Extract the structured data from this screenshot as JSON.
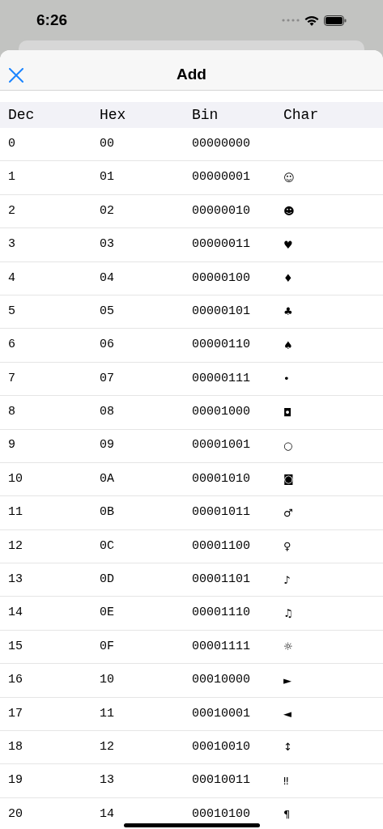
{
  "status_bar": {
    "time": "6:26"
  },
  "nav": {
    "title": "Add"
  },
  "table": {
    "columns": [
      "Dec",
      "Hex",
      "Bin",
      "Char"
    ],
    "rows": [
      {
        "dec": "0",
        "hex": "00",
        "bin": "00000000"
      },
      {
        "dec": "1",
        "hex": "01",
        "bin": "00000001",
        "char": "☺"
      },
      {
        "dec": "2",
        "hex": "02",
        "bin": "00000010",
        "char": "☻"
      },
      {
        "dec": "3",
        "hex": "03",
        "bin": "00000011",
        "char": "♥"
      },
      {
        "dec": "4",
        "hex": "04",
        "bin": "00000100",
        "char": "♦"
      },
      {
        "dec": "5",
        "hex": "05",
        "bin": "00000101",
        "char": "♣"
      },
      {
        "dec": "6",
        "hex": "06",
        "bin": "00000110",
        "char": "♠"
      },
      {
        "dec": "7",
        "hex": "07",
        "bin": "00000111",
        "char": "•"
      },
      {
        "dec": "8",
        "hex": "08",
        "bin": "00001000",
        "char": "◘"
      },
      {
        "dec": "9",
        "hex": "09",
        "bin": "00001001",
        "char": "○"
      },
      {
        "dec": "10",
        "hex": "0A",
        "bin": "00001010",
        "char": "◙"
      },
      {
        "dec": "11",
        "hex": "0B",
        "bin": "00001011",
        "char": "♂"
      },
      {
        "dec": "12",
        "hex": "0C",
        "bin": "00001100",
        "char": "♀"
      },
      {
        "dec": "13",
        "hex": "0D",
        "bin": "00001101",
        "char": "♪"
      },
      {
        "dec": "14",
        "hex": "0E",
        "bin": "00001110",
        "char": "♫"
      },
      {
        "dec": "15",
        "hex": "0F",
        "bin": "00001111",
        "char": "☼"
      },
      {
        "dec": "16",
        "hex": "10",
        "bin": "00010000",
        "char": "►"
      },
      {
        "dec": "17",
        "hex": "11",
        "bin": "00010001",
        "char": "◄"
      },
      {
        "dec": "18",
        "hex": "12",
        "bin": "00010010",
        "char": "↕"
      },
      {
        "dec": "19",
        "hex": "13",
        "bin": "00010011",
        "char": "‼"
      },
      {
        "dec": "20",
        "hex": "14",
        "bin": "00010100",
        "char": "¶"
      }
    ]
  }
}
